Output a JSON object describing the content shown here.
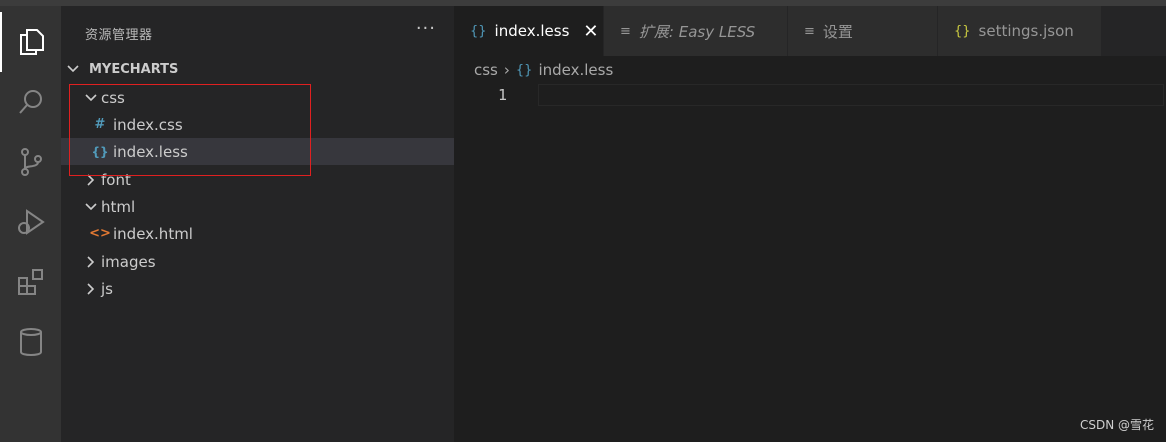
{
  "sidebar": {
    "title": "资源管理器",
    "more_label": "···",
    "section_label": "MYECHARTS",
    "tree": [
      {
        "label": "css",
        "type": "folder",
        "expanded": true,
        "icon": "chevron-down-icon"
      },
      {
        "label": "index.css",
        "type": "file",
        "icon": "css-file-icon",
        "glyph": "#"
      },
      {
        "label": "index.less",
        "type": "file",
        "icon": "less-file-icon",
        "glyph": "{}",
        "selected": true
      },
      {
        "label": "font",
        "type": "folder",
        "expanded": false,
        "icon": "chevron-right-icon"
      },
      {
        "label": "html",
        "type": "folder",
        "expanded": true,
        "icon": "chevron-down-icon"
      },
      {
        "label": "index.html",
        "type": "file",
        "icon": "html-file-icon",
        "glyph": "<>"
      },
      {
        "label": "images",
        "type": "folder",
        "expanded": false,
        "icon": "chevron-right-icon"
      },
      {
        "label": "js",
        "type": "folder",
        "expanded": false,
        "icon": "chevron-right-icon"
      }
    ]
  },
  "tabs": [
    {
      "label": "index.less",
      "icon": "{}",
      "active": true,
      "close": "✕"
    },
    {
      "label": "扩展: Easy LESS",
      "icon": "≡",
      "active": false
    },
    {
      "label": "设置",
      "icon": "≡",
      "active": false
    },
    {
      "label": "settings.json",
      "icon": "{}",
      "active": false
    }
  ],
  "breadcrumb": {
    "folder": "css",
    "separator": "›",
    "file_icon": "{}",
    "file": "index.less"
  },
  "editor": {
    "line_number": "1"
  },
  "watermark": "CSDN @雪花",
  "colors": {
    "accent_less": "#519aba",
    "html_icon": "#e37933",
    "annotation": "#e02020",
    "json_icon": "#cbcb41"
  }
}
